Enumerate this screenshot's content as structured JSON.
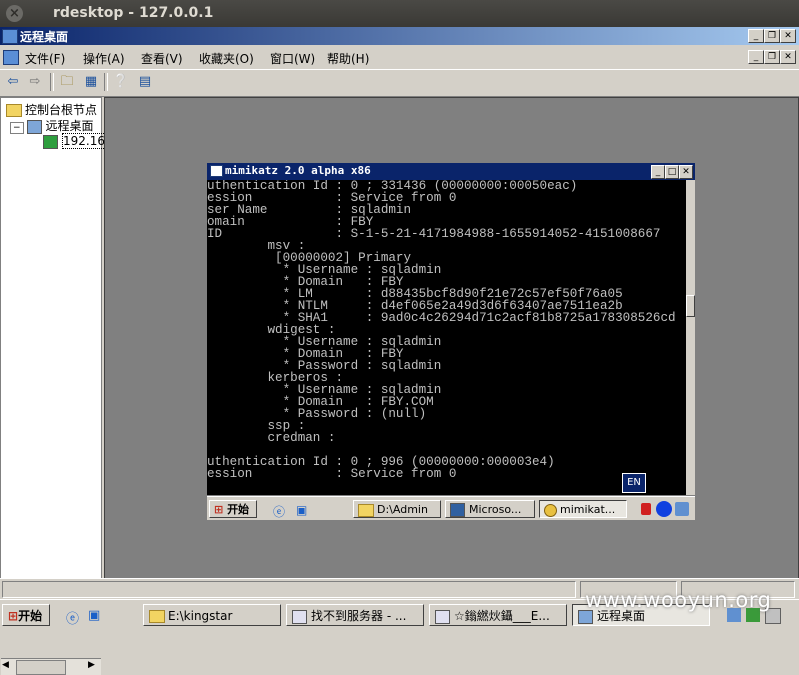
{
  "outer_window": {
    "title": "rdesktop - 127.0.0.1",
    "close_glyph": "×"
  },
  "mmc": {
    "title": "远程桌面",
    "menus": [
      "文件(F)",
      "操作(A)",
      "查看(V)",
      "收藏夹(O)",
      "窗口(W)",
      "帮助(H)"
    ],
    "tree": {
      "root": "控制台根节点",
      "child": "远程桌面",
      "leaf": "192.16"
    }
  },
  "console": {
    "title": "mimikatz 2.0 alpha x86",
    "lines": [
      "uthentication Id : 0 ; 331436 (00000000:00050eac)",
      "ession           : Service from 0",
      "ser Name         : sqladmin",
      "omain            : FBY",
      "ID               : S-1-5-21-4171984988-1655914052-4151008667",
      "        msv :",
      "         [00000002] Primary",
      "          * Username : sqladmin",
      "          * Domain   : FBY",
      "          * LM       : d88435bcf8d90f21e72c57ef50f76a05",
      "          * NTLM     : d4ef065e2a49d3d6f63407ae7511ea2b",
      "          * SHA1     : 9ad0c4c26294d71c2acf81b8725a178308526cd",
      "        wdigest :",
      "          * Username : sqladmin",
      "          * Domain   : FBY",
      "          * Password : sqladmin",
      "        kerberos :",
      "          * Username : sqladmin",
      "          * Domain   : FBY.COM",
      "          * Password : (null)",
      "        ssp :",
      "        credman :",
      "",
      "uthentication Id : 0 ; 996 (00000000:000003e4)",
      "ession           : Service from 0"
    ],
    "ime": "EN"
  },
  "inner_taskbar": {
    "start": "开始",
    "items": [
      "D:\\Admin",
      "Microso...",
      "mimikat..."
    ]
  },
  "taskbar": {
    "start": "开始",
    "items": [
      "E:\\kingstar",
      "找不到服务器 - ...",
      "☆鎓繎炏鑷___E...",
      "远程桌面"
    ]
  },
  "watermark": "www.wooyun.org"
}
